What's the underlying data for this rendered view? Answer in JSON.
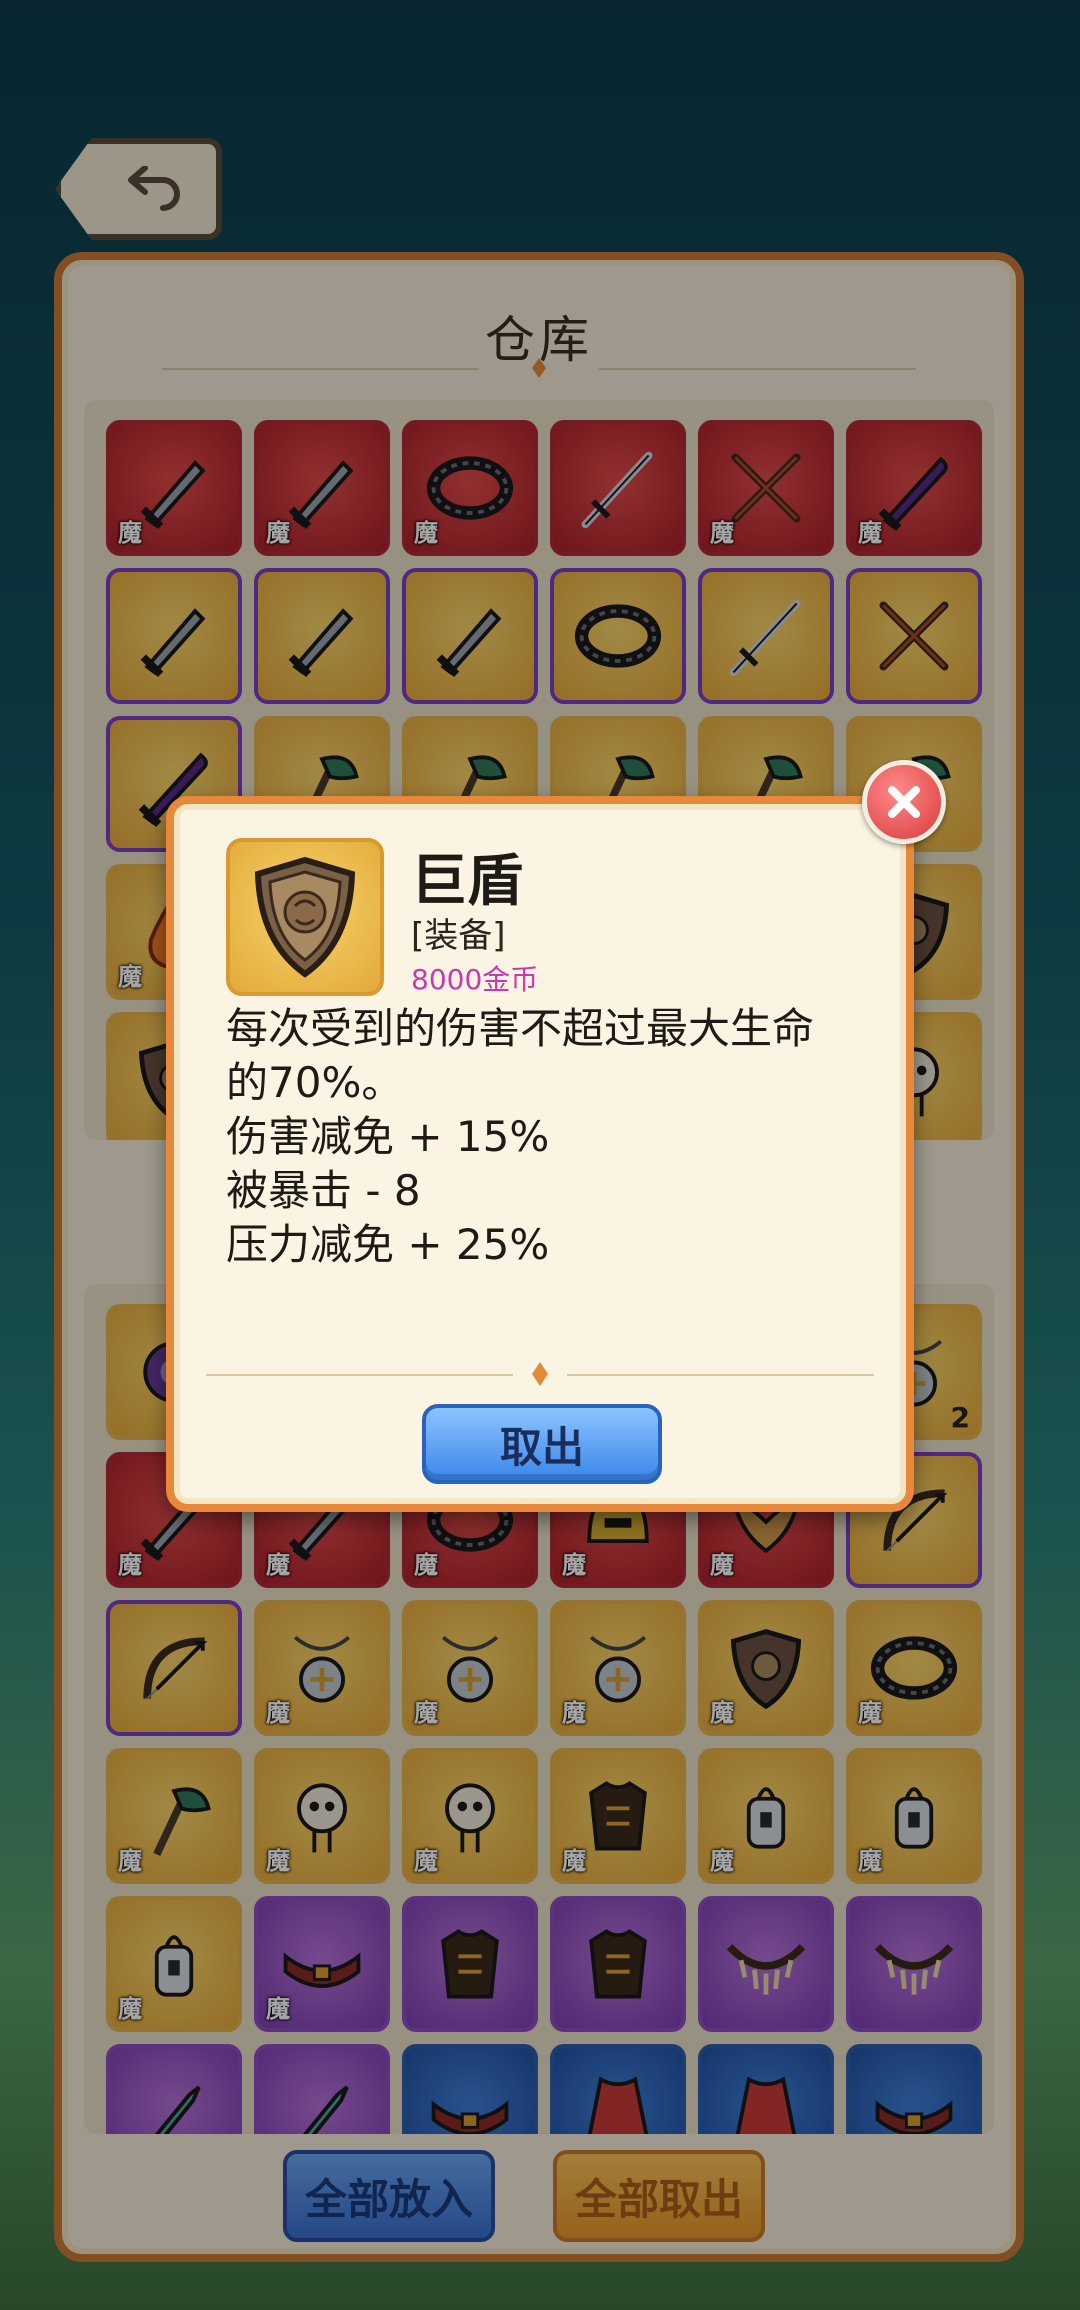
{
  "warehouse": {
    "title": "仓库",
    "mo_label": "魔",
    "top_rows": [
      [
        {
          "color": "red",
          "icon": "sword",
          "mo": true
        },
        {
          "color": "red",
          "icon": "sword",
          "mo": true
        },
        {
          "color": "red",
          "icon": "ring",
          "mo": true
        },
        {
          "color": "red",
          "icon": "longsword",
          "mo": false
        },
        {
          "color": "red",
          "icon": "crossed-swords",
          "mo": true
        },
        {
          "color": "red",
          "icon": "dark-sword",
          "mo": true
        }
      ],
      [
        {
          "color": "gold",
          "icon": "sword",
          "mo": false,
          "pb": true
        },
        {
          "color": "gold",
          "icon": "sword",
          "mo": false,
          "pb": true
        },
        {
          "color": "gold",
          "icon": "sword",
          "mo": false,
          "pb": true
        },
        {
          "color": "gold",
          "icon": "ring",
          "mo": false,
          "pb": true
        },
        {
          "color": "gold",
          "icon": "longsword",
          "mo": false,
          "pb": true
        },
        {
          "color": "gold",
          "icon": "crossed-swords",
          "mo": false,
          "pb": true
        }
      ],
      [
        {
          "color": "gold",
          "icon": "dark-sword",
          "mo": false,
          "pb": true
        },
        {
          "color": "gold",
          "icon": "axe",
          "mo": false
        },
        {
          "color": "gold",
          "icon": "axe",
          "mo": false
        },
        {
          "color": "gold",
          "icon": "axe",
          "mo": false
        },
        {
          "color": "gold",
          "icon": "axe",
          "mo": false
        },
        {
          "color": "gold",
          "icon": "axe",
          "mo": false
        }
      ],
      [
        {
          "color": "gold",
          "icon": "flame",
          "mo": true
        },
        {
          "color": "gold",
          "icon": "axe",
          "mo": false
        },
        {
          "color": "gold",
          "icon": "axe",
          "mo": false
        },
        {
          "color": "gold",
          "icon": "axe",
          "mo": false
        },
        {
          "color": "gold",
          "icon": "axe",
          "mo": false
        },
        {
          "color": "gold",
          "icon": "shield",
          "mo": false
        }
      ],
      [
        {
          "color": "gold",
          "icon": "shield",
          "mo": false
        },
        {
          "color": "gold",
          "icon": "axe",
          "mo": false
        },
        {
          "color": "gold",
          "icon": "axe",
          "mo": false
        },
        {
          "color": "gold",
          "icon": "axe",
          "mo": false
        },
        {
          "color": "gold",
          "icon": "axe",
          "mo": false
        },
        {
          "color": "gold",
          "icon": "skull",
          "mo": false
        }
      ]
    ],
    "bottom_rows": [
      [
        {
          "color": "gold",
          "icon": "orb",
          "mo": false
        },
        {
          "color": "gold",
          "icon": "orb",
          "mo": false
        },
        {
          "color": "gold",
          "icon": "orb",
          "mo": false
        },
        {
          "color": "gold",
          "icon": "orb",
          "mo": false
        },
        {
          "color": "gold",
          "icon": "orb",
          "mo": false
        },
        {
          "color": "gold",
          "icon": "amulet",
          "mo": false,
          "count": "2"
        }
      ],
      [
        {
          "color": "red",
          "icon": "sword",
          "mo": true
        },
        {
          "color": "red",
          "icon": "sword",
          "mo": true
        },
        {
          "color": "red",
          "icon": "ring",
          "mo": true
        },
        {
          "color": "red",
          "icon": "helmet",
          "mo": true
        },
        {
          "color": "red",
          "icon": "wings",
          "mo": true
        },
        {
          "color": "gold",
          "icon": "bow",
          "mo": false,
          "pb": true
        }
      ],
      [
        {
          "color": "gold",
          "icon": "bow",
          "mo": false,
          "pb": true
        },
        {
          "color": "gold",
          "icon": "amulet",
          "mo": true
        },
        {
          "color": "gold",
          "icon": "amulet",
          "mo": true
        },
        {
          "color": "gold",
          "icon": "amulet",
          "mo": true
        },
        {
          "color": "gold",
          "icon": "shield",
          "mo": true
        },
        {
          "color": "gold",
          "icon": "ring",
          "mo": true
        }
      ],
      [
        {
          "color": "gold",
          "icon": "axe",
          "mo": true
        },
        {
          "color": "gold",
          "icon": "skull",
          "mo": true
        },
        {
          "color": "gold",
          "icon": "skull",
          "mo": true
        },
        {
          "color": "gold",
          "icon": "armor",
          "mo": true
        },
        {
          "color": "gold",
          "icon": "lantern",
          "mo": true
        },
        {
          "color": "gold",
          "icon": "lantern",
          "mo": true
        }
      ],
      [
        {
          "color": "gold",
          "icon": "lantern",
          "mo": true
        },
        {
          "color": "purple",
          "icon": "belt",
          "mo": true
        },
        {
          "color": "purple",
          "icon": "armor",
          "mo": false
        },
        {
          "color": "purple",
          "icon": "armor",
          "mo": false
        },
        {
          "color": "purple",
          "icon": "necklace",
          "mo": false
        },
        {
          "color": "purple",
          "icon": "necklace",
          "mo": false
        }
      ],
      [
        {
          "color": "purple",
          "icon": "dagger",
          "mo": false
        },
        {
          "color": "purple",
          "icon": "dagger",
          "mo": false
        },
        {
          "color": "blue",
          "icon": "belt",
          "mo": false
        },
        {
          "color": "blue",
          "icon": "cloak",
          "mo": false
        },
        {
          "color": "blue",
          "icon": "cloak",
          "mo": false
        },
        {
          "color": "blue",
          "icon": "belt",
          "mo": false
        }
      ]
    ],
    "put_all_label": "全部放入",
    "take_all_label": "全部取出"
  },
  "popup": {
    "item_name": "巨盾",
    "item_type": "[装备]",
    "item_price": "8000金币",
    "desc_lines": [
      "每次受到的伤害不超过最大生命",
      "的70%。",
      "伤害减免 + 15%",
      "被暴击 - 8",
      "压力减免 + 25%"
    ],
    "take_button": "取出",
    "icon": "shield-icon"
  },
  "colors": {
    "panel_border": "#c87a3a",
    "popup_border": "#e8883a",
    "price": "#c83ab0"
  }
}
